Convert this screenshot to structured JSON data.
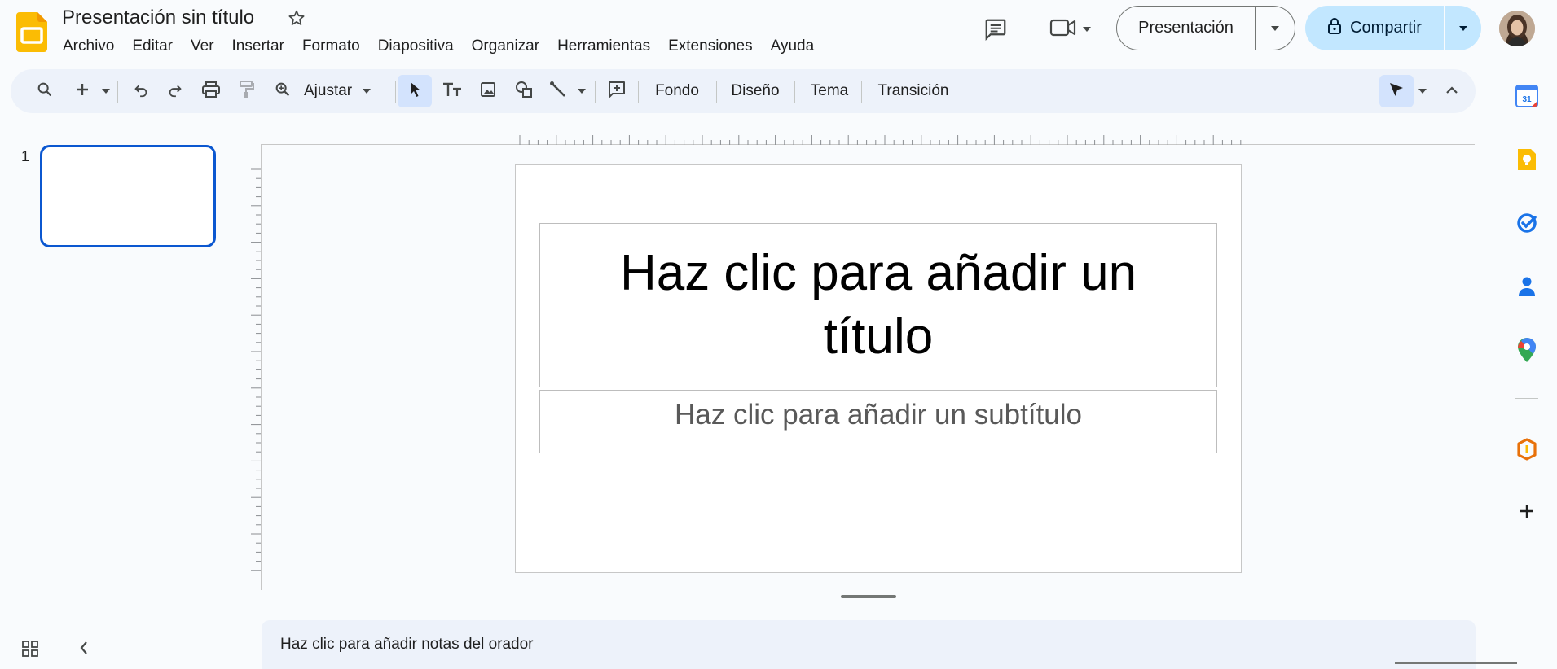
{
  "header": {
    "title": "Presentación sin título",
    "menu": [
      "Archivo",
      "Editar",
      "Ver",
      "Insertar",
      "Formato",
      "Diapositiva",
      "Organizar",
      "Herramientas",
      "Extensiones",
      "Ayuda"
    ],
    "present_label": "Presentación",
    "share_label": "Compartir"
  },
  "toolbar": {
    "zoom_label": "Ajustar",
    "background_label": "Fondo",
    "layout_label": "Diseño",
    "theme_label": "Tema",
    "transition_label": "Transición"
  },
  "filmstrip": {
    "slide_number": "1"
  },
  "slide": {
    "title_placeholder": "Haz clic para añadir un título",
    "subtitle_placeholder": "Haz clic para añadir un subtítulo"
  },
  "notes": {
    "placeholder": "Haz clic para añadir notas del orador"
  },
  "side_panel": {
    "calendar_day": "31"
  },
  "colors": {
    "accent": "#0b57d0",
    "share_bg": "#c2e7ff",
    "toolbar_bg": "#edf2fa",
    "slides_yellow": "#fbbc04"
  },
  "icons": [
    "slides-logo-icon",
    "star-icon",
    "comments-icon",
    "meet-icon",
    "lock-icon",
    "search-icon",
    "plus-icon",
    "undo-icon",
    "redo-icon",
    "print-icon",
    "paint-format-icon",
    "zoom-icon",
    "select-icon",
    "text-box-icon",
    "image-icon",
    "shape-icon",
    "line-icon",
    "comment-add-icon",
    "cursor-mode-icon",
    "chevron-up-icon",
    "grid-icon",
    "chevron-left-icon",
    "calendar-icon",
    "keep-icon",
    "tasks-icon",
    "contacts-icon",
    "maps-icon",
    "office-icon"
  ]
}
